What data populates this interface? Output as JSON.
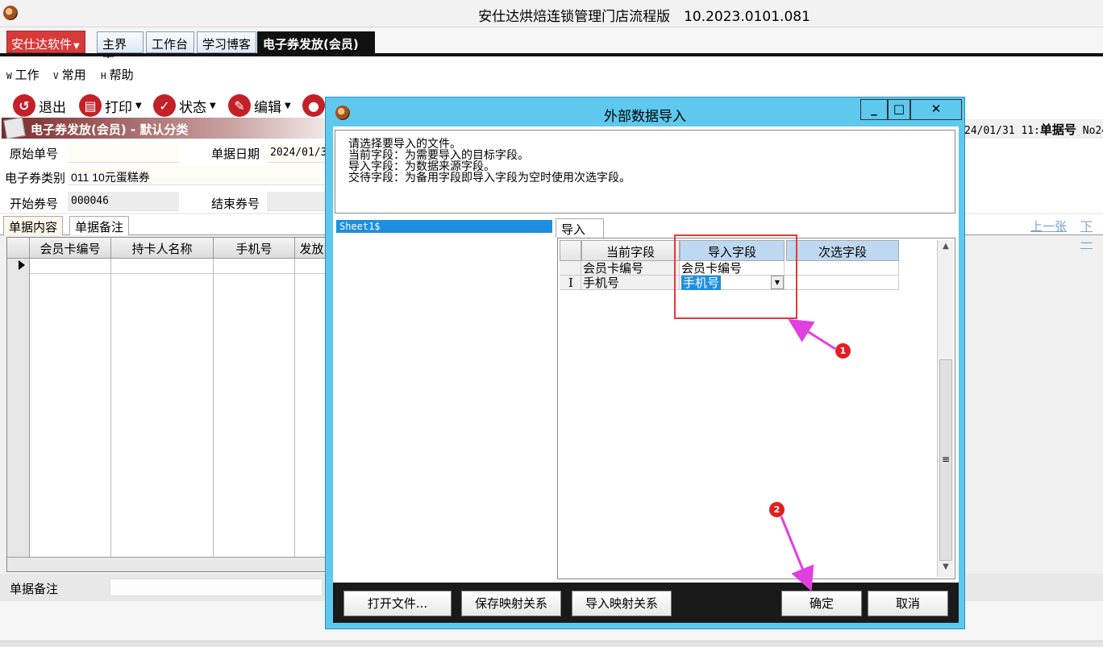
{
  "window": {
    "title": "安仕达烘焙连锁管理门店流程版　10.2023.0101.081"
  },
  "brand_button": "安仕达软件",
  "top_tabs": [
    "主界面",
    "工作台",
    "学习博客",
    "电子券发放(会员)"
  ],
  "menu": [
    {
      "key": "W",
      "label": "工作"
    },
    {
      "key": "V",
      "label": "常用"
    },
    {
      "key": "H",
      "label": "帮助"
    }
  ],
  "toolbar": [
    {
      "label": "退出",
      "icon": "exit-icon"
    },
    {
      "label": "打印",
      "icon": "print-icon"
    },
    {
      "label": "状态",
      "icon": "status-check-icon"
    },
    {
      "label": "编辑",
      "icon": "edit-icon"
    }
  ],
  "form": {
    "header": "电子券发放(会员) - 默认分类",
    "original_no_label": "原始单号",
    "original_no_value": "",
    "doc_date_label": "单据日期",
    "doc_date_value": "2024/01/3",
    "coupon_type_label": "电子券类别",
    "coupon_type_value": "011 10元蛋糕券",
    "start_no_label": "开始券号",
    "start_no_value": "000046",
    "end_no_label": "结束券号",
    "end_no_value": "",
    "right_date": "24/01/31 11:",
    "doc_no_label": "单据号",
    "doc_no_value": "No24"
  },
  "sub_tabs": [
    "单据内容",
    "单据备注"
  ],
  "nav_links": [
    "上一张",
    "下一"
  ],
  "grid": {
    "columns": [
      "会员卡编号",
      "持卡人名称",
      "手机号",
      "发放"
    ]
  },
  "remark_label": "单据备注",
  "dialog": {
    "title": "外部数据导入",
    "instructions": [
      "请选择要导入的文件。",
      "当前字段：为需要导入的目标字段。",
      "导入字段：为数据来源字段。",
      "交待字段：为备用字段即导入字段为空时使用次选字段。"
    ],
    "sheet": "Sheet1$",
    "tab": "导入",
    "map_headers": [
      "当前字段",
      "导入字段",
      "次选字段"
    ],
    "map_rows": [
      {
        "current": "会员卡编号",
        "import": "会员卡编号",
        "alt": ""
      },
      {
        "current": "手机号",
        "import": "手机号",
        "alt": ""
      }
    ],
    "buttons": {
      "open": "打开文件...",
      "save_map": "保存映射关系",
      "import_map": "导入映射关系",
      "ok": "确定",
      "cancel": "取消"
    }
  },
  "annotations": [
    "1",
    "2"
  ],
  "colors": {
    "dialog_frame": "#5ec8ee",
    "brand": "#d83a3a",
    "highlight": "#e03a3a",
    "arrow": "#e040e0",
    "selection": "#1e8fe0"
  }
}
